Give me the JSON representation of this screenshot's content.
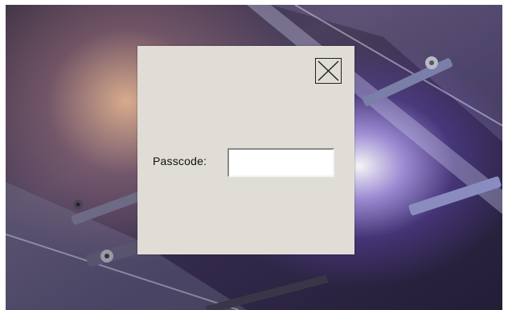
{
  "dialog": {
    "close_icon": "close-x-icon",
    "passcode_label": "Passcode:",
    "passcode_value": "",
    "passcode_placeholder": ""
  },
  "colors": {
    "dialog_bg": "#e0ddd6",
    "input_bg": "#ffffff"
  }
}
